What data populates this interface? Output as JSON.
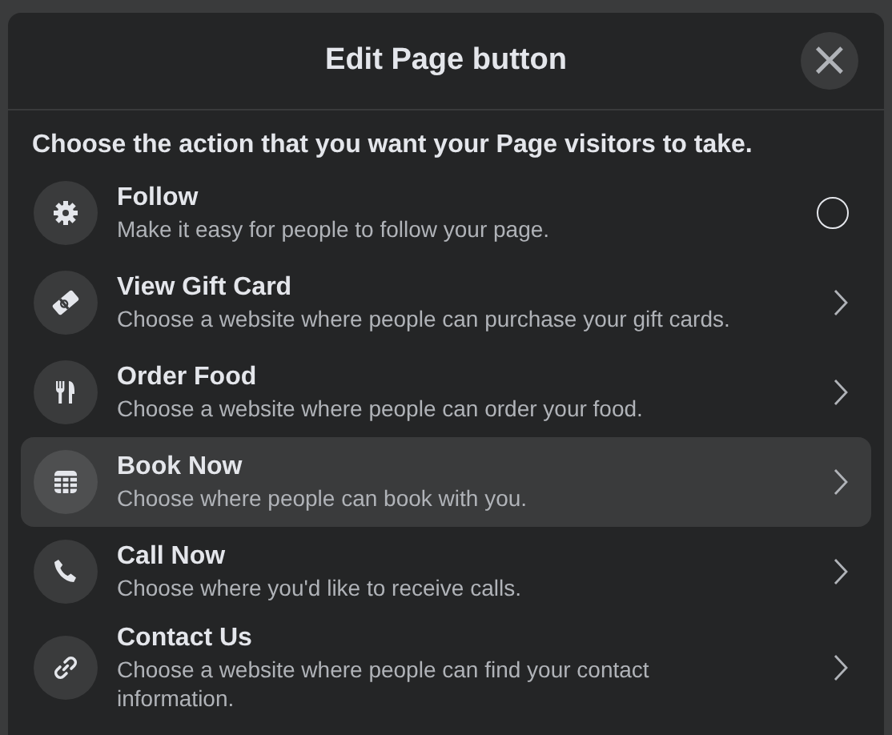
{
  "dialog": {
    "title": "Edit Page button",
    "close": "×"
  },
  "prompt": "Choose the action that you want your Page visitors to take.",
  "actions": [
    {
      "kind": "radio",
      "title": "Follow",
      "description": "Make it easy for people to follow your page.",
      "selected": false,
      "hovered": false
    },
    {
      "kind": "chevron",
      "title": "View Gift Card",
      "description": "Choose a website where people can purchase your gift cards.",
      "hovered": false
    },
    {
      "kind": "chevron",
      "title": "Order Food",
      "description": "Choose a website where people can order your food.",
      "hovered": false
    },
    {
      "kind": "chevron",
      "title": "Book Now",
      "description": "Choose where people can book with you.",
      "hovered": true
    },
    {
      "kind": "chevron",
      "title": "Call Now",
      "description": "Choose where you'd like to receive calls.",
      "hovered": false
    },
    {
      "kind": "chevron",
      "title": "Contact Us",
      "description": "Choose a website where people can find your contact information.",
      "hovered": false
    }
  ]
}
